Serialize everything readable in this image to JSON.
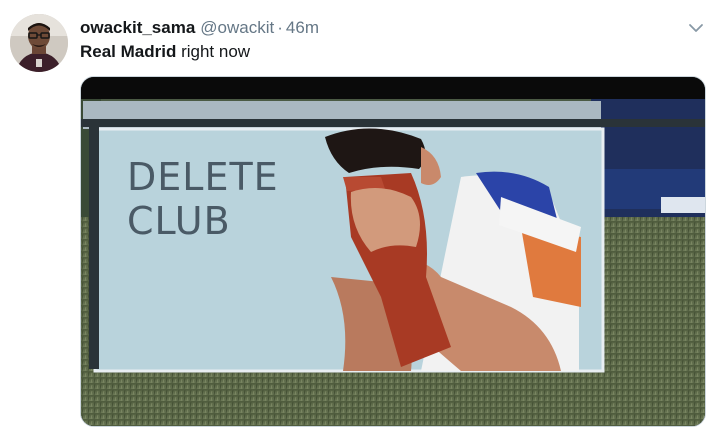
{
  "tweet": {
    "display_name": "owackit_sama",
    "handle": "@owackit",
    "separator": "·",
    "timestamp": "46m",
    "text_bold": "Real Madrid",
    "text_rest": " right now"
  },
  "media": {
    "caption_line1": "DELETE",
    "caption_line2": "CLUB"
  },
  "icons": {
    "menu": "chevron-down-icon",
    "avatar": "user-avatar"
  },
  "colors": {
    "text": "#14171a",
    "secondary_text": "#657786",
    "border": "#ccd6dd"
  }
}
